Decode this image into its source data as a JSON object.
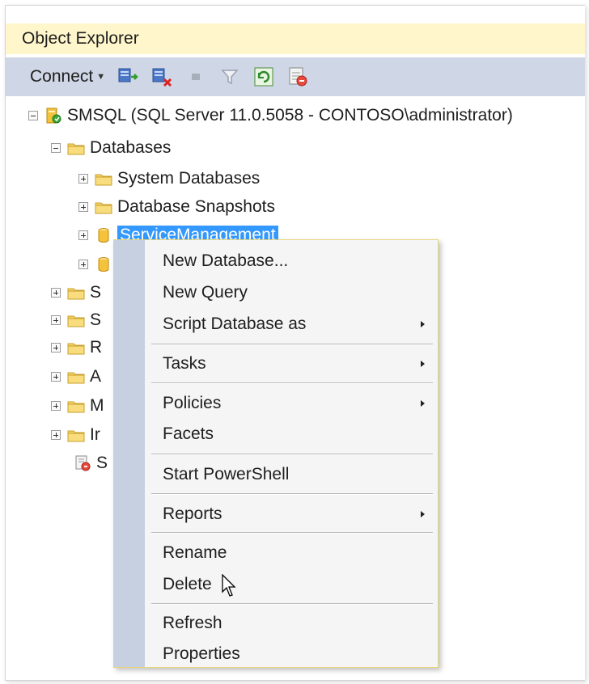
{
  "panel": {
    "title": "Object Explorer"
  },
  "toolbar": {
    "connect_label": "Connect",
    "icons": [
      "connect-server-icon",
      "disconnect-icon",
      "stop-icon",
      "filter-icon",
      "refresh-icon",
      "activity-monitor-icon"
    ]
  },
  "tree": {
    "server": "SMSQL (SQL Server 11.0.5058 - CONTOSO\\administrator)",
    "databases": "Databases",
    "system_databases": "System Databases",
    "database_snapshots": "Database Snapshots",
    "selected_db": "ServiceManagement",
    "partial_nodes": [
      "S",
      "S",
      "R",
      "A",
      "M",
      "Ir",
      "S"
    ]
  },
  "context_menu": {
    "items": [
      {
        "label": "New Database..."
      },
      {
        "label": "New Query"
      },
      {
        "label": "Script Database as"
      },
      {
        "label": "Tasks"
      },
      {
        "label": "Policies"
      },
      {
        "label": "Facets"
      },
      {
        "label": "Start PowerShell"
      },
      {
        "label": "Reports"
      },
      {
        "label": "Rename"
      },
      {
        "label": "Delete"
      },
      {
        "label": "Refresh"
      },
      {
        "label": "Properties"
      }
    ]
  },
  "colors": {
    "title_bar": "#fff6cc",
    "toolbar": "#cfd6e5",
    "selection": "#3399ff",
    "menu_gutter": "#c6d0e0",
    "menu_border": "#e8d57a"
  }
}
